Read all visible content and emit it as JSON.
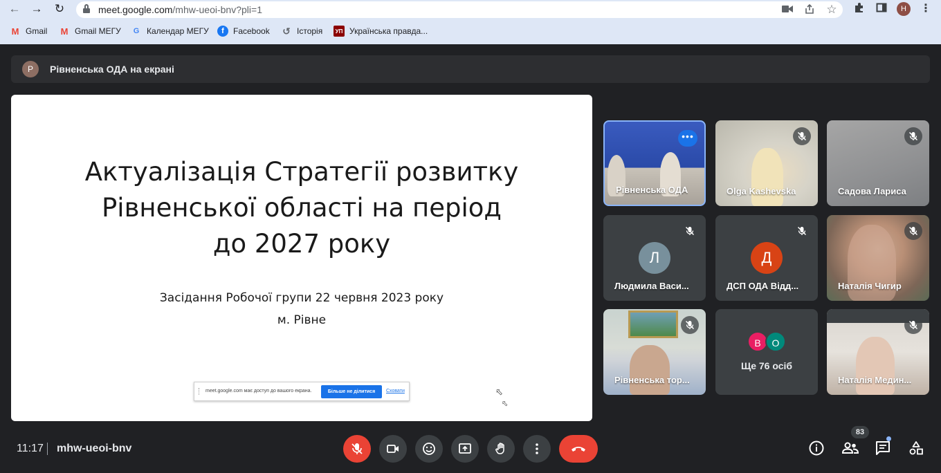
{
  "browser": {
    "url_host": "meet.google.com",
    "url_path": "/mhw-ueoi-bnv?pli=1",
    "profile_initial": "H",
    "bookmarks": [
      {
        "label": "Gmail",
        "icon": "gmail-icon"
      },
      {
        "label": "Gmail МЕГУ",
        "icon": "gmail-icon"
      },
      {
        "label": "Календар МЕГУ",
        "icon": "google-icon"
      },
      {
        "label": "Facebook",
        "icon": "facebook-icon"
      },
      {
        "label": "Історія",
        "icon": "history-icon"
      },
      {
        "label": "Українська правда...",
        "icon": "up-icon",
        "icon_text": "УП"
      }
    ]
  },
  "banner": {
    "avatar_initial": "Р",
    "text": "Рівненська ОДА на екрані"
  },
  "slide": {
    "title_lines": [
      "Актуалізація Стратегії розвитку",
      "Рівненської області на період",
      "до 2027 року"
    ],
    "subtitle_lines": [
      "Засідання Робочої групи 22 червня 2023 року",
      "м. Рівне"
    ],
    "share_bar": {
      "text": "meet.google.com має доступ до вашого екрана.",
      "stop_label": "Більше не ділитися",
      "hide_label": "Сховати"
    }
  },
  "tiles": [
    {
      "name": "Рівненська ОДА",
      "muted": false,
      "active": true
    },
    {
      "name": "Olga Kashevska",
      "muted": true
    },
    {
      "name": "Садова Лариса",
      "muted": true
    },
    {
      "name": "Людмила Васи...",
      "muted": true,
      "avatar_initial": "Л",
      "avatar_color": "#78909c"
    },
    {
      "name": "ДСП ОДА Відд...",
      "muted": true,
      "avatar_initial": "Д",
      "avatar_color": "#d84315"
    },
    {
      "name": "Наталія Чигир",
      "muted": true
    },
    {
      "name": "Рівненська тор...",
      "muted": true
    },
    {
      "name": "Ще 76 осіб",
      "avatars": [
        {
          "initial": "В",
          "color": "#e91e63"
        },
        {
          "initial": "О",
          "color": "#00897b"
        }
      ]
    },
    {
      "name": "Наталія Медин...",
      "muted": true
    }
  ],
  "bottom_bar": {
    "time": "11:17",
    "meeting_code": "mhw-ueoi-bnv",
    "participants_count": "83"
  },
  "colors": {
    "chrome_bg": "#dee7f6",
    "meet_bg": "#202124",
    "tile_bg": "#3c4043",
    "danger": "#ea4335",
    "accent": "#8ab4f8"
  }
}
